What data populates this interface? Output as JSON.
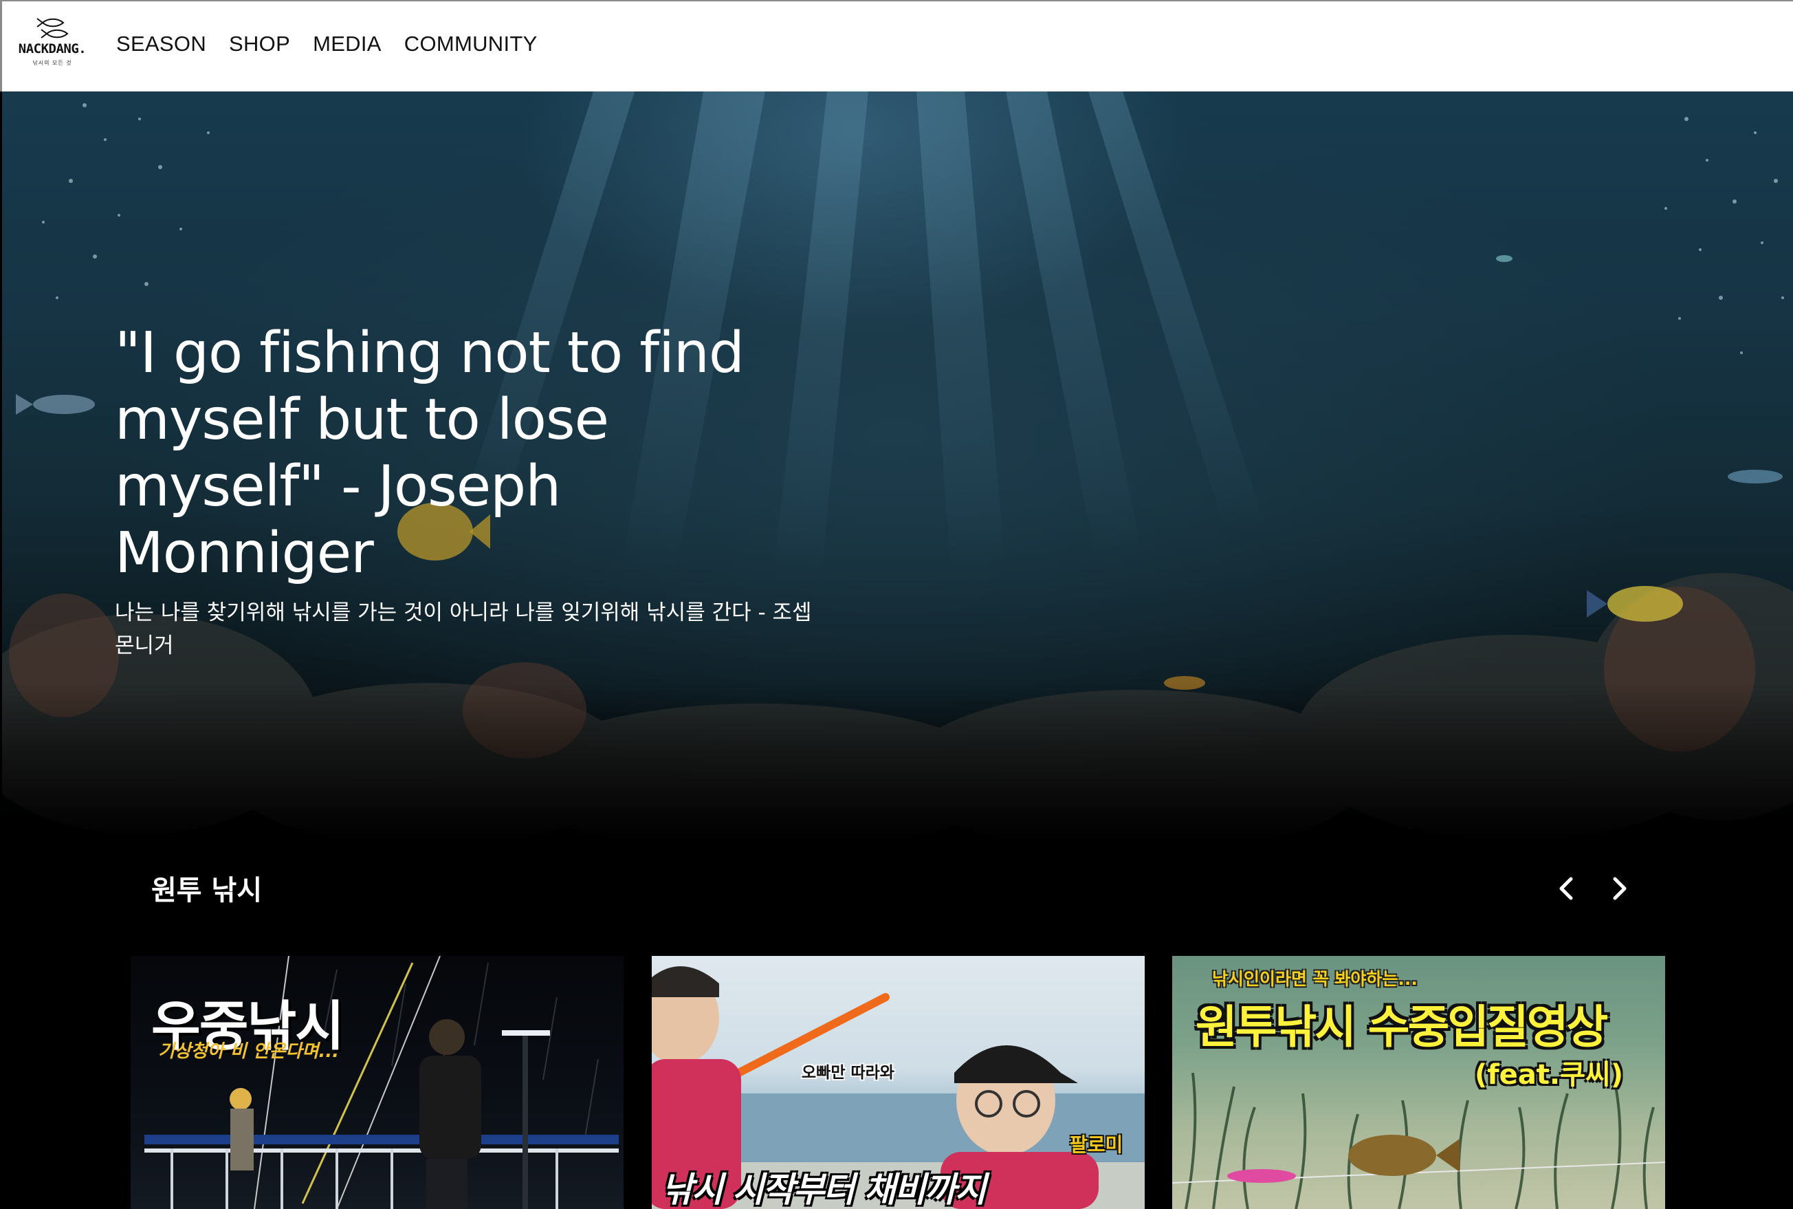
{
  "brand": {
    "name": "NACKDANG.",
    "tagline": "낚시의 모든 것"
  },
  "nav": [
    "SEASON",
    "SHOP",
    "MEDIA",
    "COMMUNITY"
  ],
  "hero": {
    "quote": "\"I go fishing not to find myself but to lose myself\" - Joseph Monniger",
    "quote_kr": "나는 나를 찾기위해 낚시를 가는 것이 아니라 나를 잊기위해 낚시를 간다 - 조셉 몬니거"
  },
  "section": {
    "title": "원투 낚시",
    "prev_icon": "chevron-left-icon",
    "next_icon": "chevron-right-icon"
  },
  "cards": [
    {
      "title": "우중낚시",
      "subtitle": "기상청아 비 안온다며..."
    },
    {
      "tag1": "오빠만 따라와",
      "tag2": "팔로미",
      "title": "낚시 시작부터 채비까지"
    },
    {
      "top": "낚시인이라면 꼭 봐야하는...",
      "title": "원투낚시 수중입질영상",
      "feat": "(feat.쿠씨)"
    }
  ],
  "colors": {
    "header_bg": "#ffffff",
    "page_bg": "#000000",
    "text_light": "#ffffff",
    "thumb_yellow": "#fff23c"
  }
}
